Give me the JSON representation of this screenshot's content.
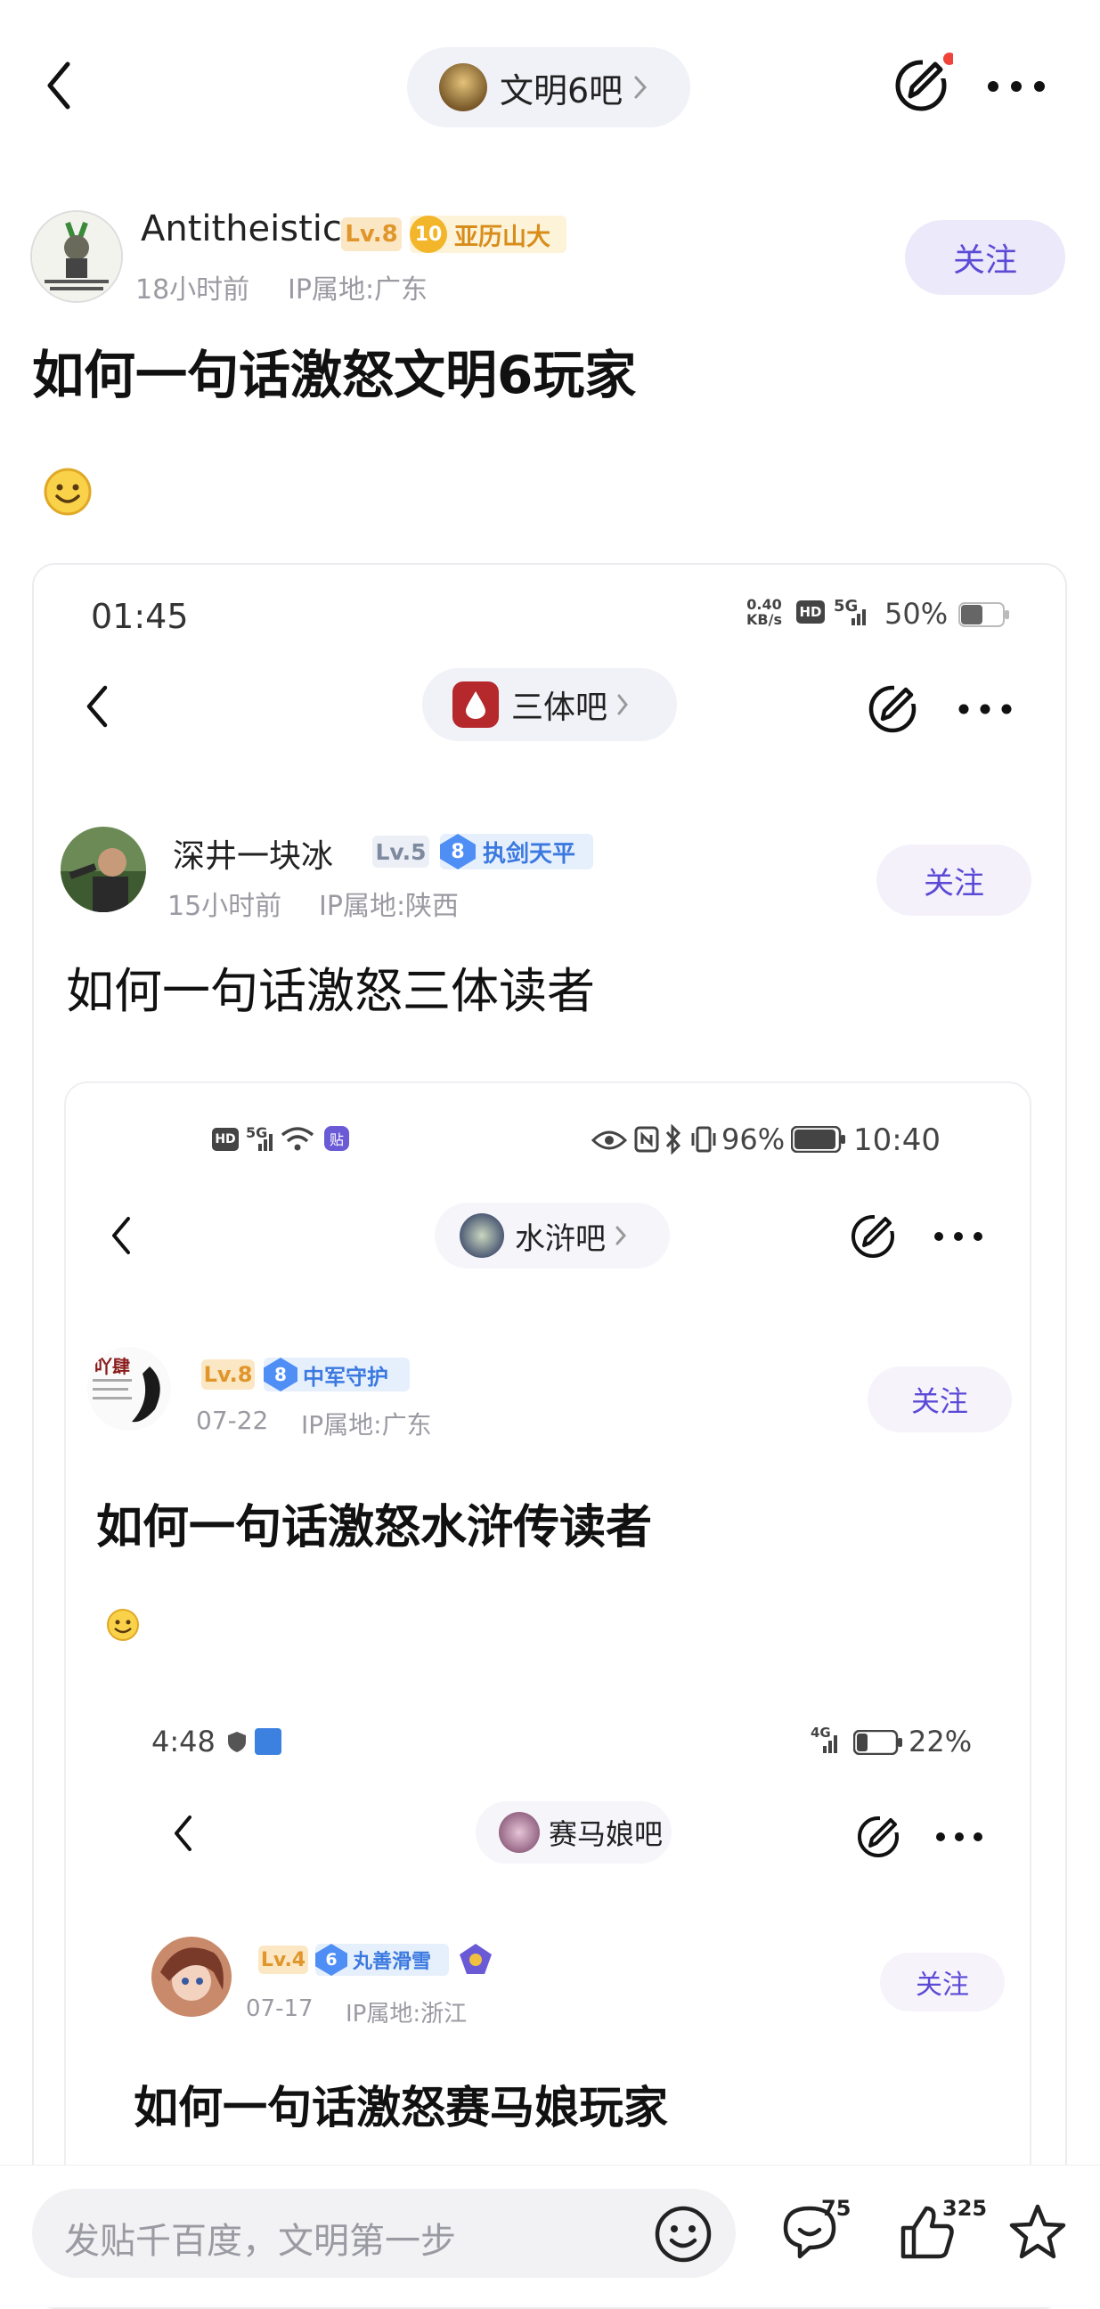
{
  "header": {
    "forum_name": "文明6吧",
    "more_label": "···"
  },
  "post": {
    "author": "Antitheistic",
    "level": "Lv.8",
    "badge_num": "10",
    "badge_name": "亚历山大",
    "time": "18小时前",
    "ip": "IP属地:广东",
    "follow": "关注",
    "title": "如何一句话激怒文明6玩家"
  },
  "shot1": {
    "clock": "01:45",
    "net_speed_top": "0.40",
    "net_speed_unit": "KB/s",
    "hd": "HD",
    "signal": "5G",
    "battery": "50%",
    "forum_name": "三体吧",
    "author": "深井一块冰",
    "level": "Lv.5",
    "badge_num": "8",
    "badge_name": "执剑天平",
    "time": "15小时前",
    "ip": "IP属地:陕西",
    "follow": "关注",
    "title": "如何一句话激怒三体读者"
  },
  "shot2": {
    "hd": "HD",
    "signal": "5G",
    "tag": "贴",
    "battery": "96%",
    "clock": "10:40",
    "forum_name": "水浒吧",
    "avatar_text": "吖肆",
    "level": "Lv.8",
    "badge_num": "8",
    "badge_name": "中军守护",
    "time": "07-22",
    "ip": "IP属地:广东",
    "follow": "关注",
    "title": "如何一句话激怒水浒传读者"
  },
  "shot3": {
    "clock": "4:48",
    "signal": "4G",
    "battery": "22%",
    "forum_name": "赛马娘吧",
    "level": "Lv.4",
    "badge_num": "6",
    "badge_name": "丸善滑雪",
    "time": "07-17",
    "ip": "IP属地:浙江",
    "follow": "关注",
    "title": "如何一句话激怒赛马娘玩家"
  },
  "bottom": {
    "placeholder": "发贴千百度，文明第一步",
    "comment_count": "75",
    "like_count": "325"
  },
  "colors": {
    "accent": "#5b4ad6",
    "follow_bg": "#ece9fa",
    "level": "#e0962a",
    "badge_gold": "#f3b52a",
    "badge_blue": "#4f8ef5",
    "notify_dot": "#f0433a"
  },
  "icons": [
    "back-icon",
    "edit-icon",
    "more-icon",
    "emoji-icon",
    "comment-icon",
    "like-icon",
    "star-icon",
    "chevron-right-icon",
    "battery-icon",
    "wifi-icon",
    "eye-icon",
    "bluetooth-icon"
  ]
}
